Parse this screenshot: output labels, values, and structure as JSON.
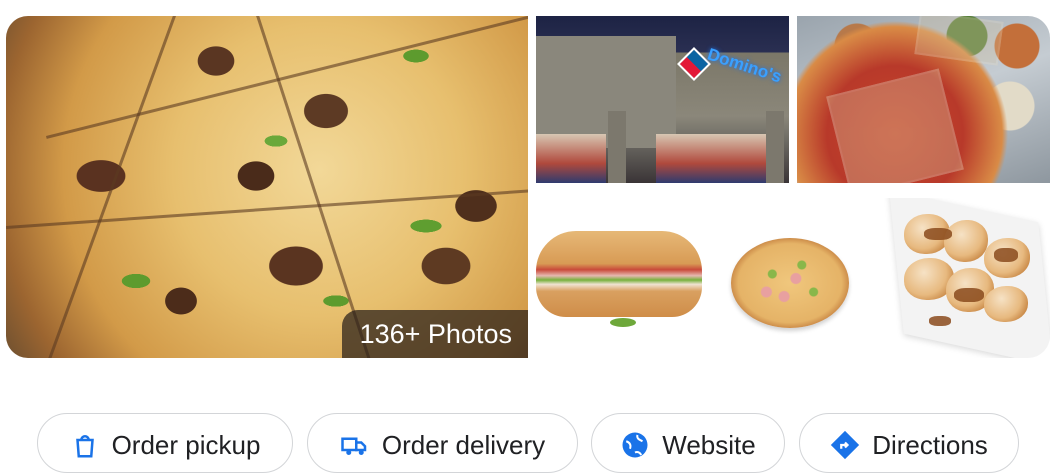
{
  "gallery": {
    "photos_count_label": "136+ Photos",
    "store_sign_text": "Domino's"
  },
  "actions": [
    {
      "label": "Order pickup",
      "icon": "pickup-bag-icon"
    },
    {
      "label": "Order delivery",
      "icon": "delivery-icon"
    },
    {
      "label": "Website",
      "icon": "globe-icon"
    },
    {
      "label": "Directions",
      "icon": "directions-icon"
    }
  ],
  "colors": {
    "accent_blue": "#1a73e8",
    "chip_border": "#d3d5d8",
    "text": "#202124"
  }
}
